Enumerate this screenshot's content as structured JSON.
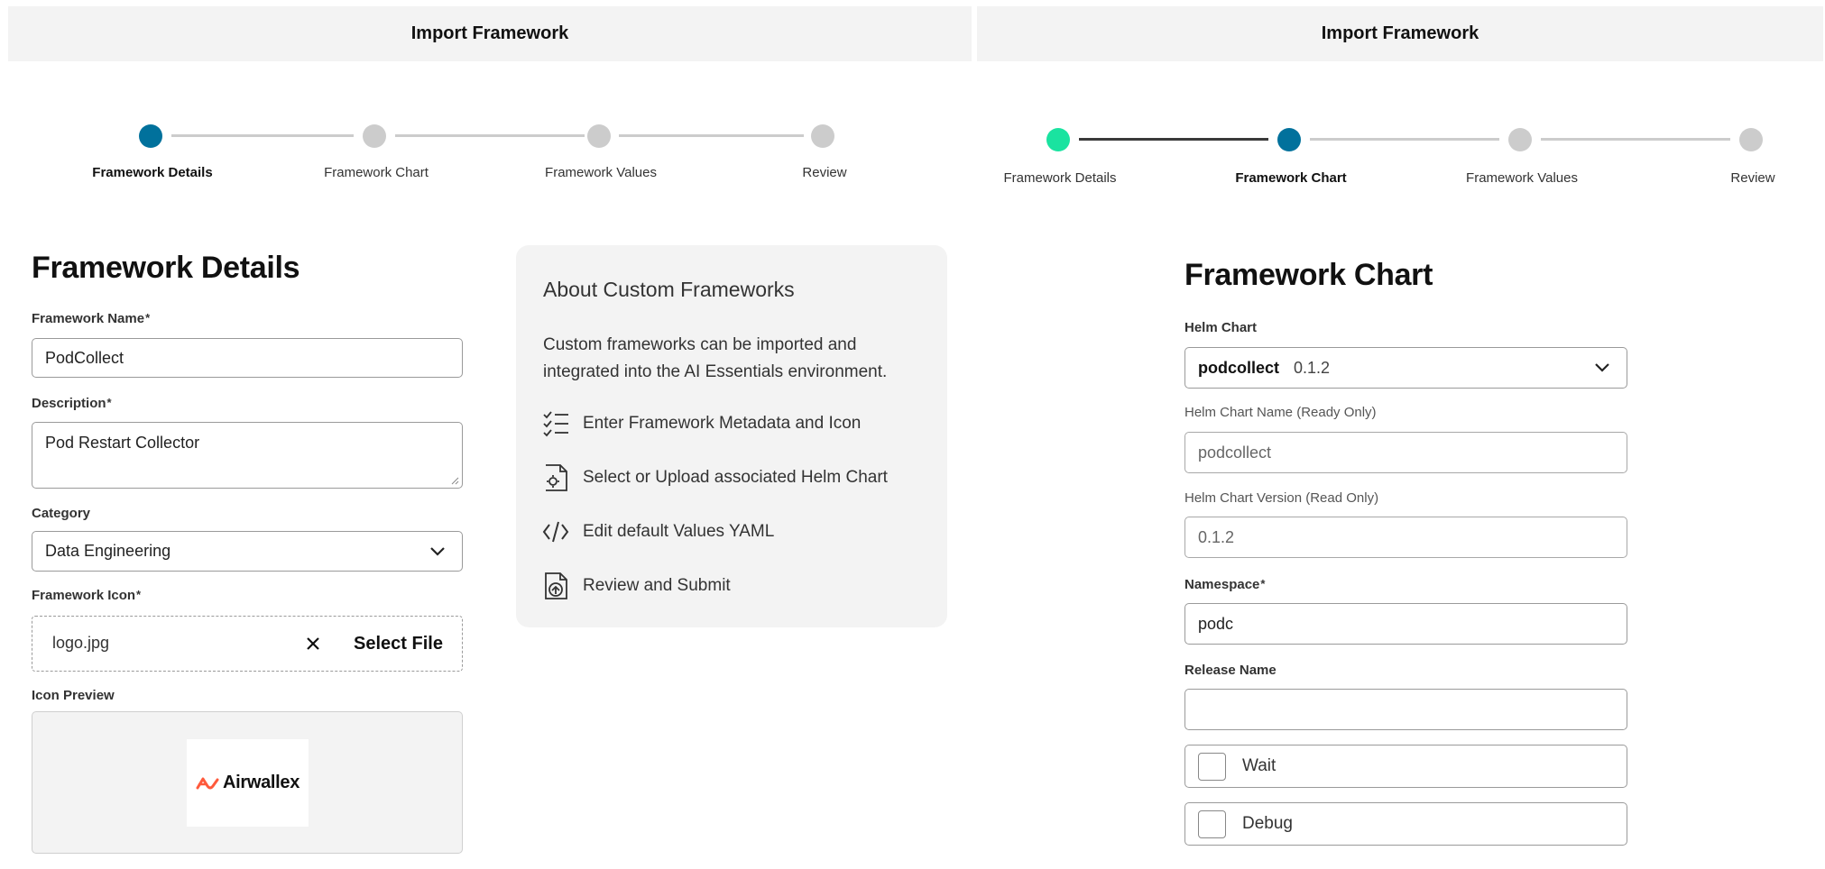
{
  "left": {
    "header_title": "Import Framework",
    "steps": [
      {
        "label": "Framework Details",
        "state": "active"
      },
      {
        "label": "Framework Chart",
        "state": "pending"
      },
      {
        "label": "Framework Values",
        "state": "pending"
      },
      {
        "label": "Review",
        "state": "pending"
      }
    ],
    "section_title": "Framework Details",
    "framework_name": {
      "label": "Framework Name",
      "required": "*",
      "value": "PodCollect"
    },
    "description": {
      "label": "Description",
      "required": "*",
      "value": "Pod Restart Collector"
    },
    "category": {
      "label": "Category",
      "value": "Data Engineering"
    },
    "framework_icon": {
      "label": "Framework Icon",
      "required": "*",
      "file_name": "logo.jpg",
      "select_label": "Select File"
    },
    "icon_preview": {
      "label": "Icon Preview",
      "logo_text": "Airwallex"
    },
    "about": {
      "title": "About Custom Frameworks",
      "text": "Custom frameworks can be imported and integrated into the AI Essentials environment.",
      "items": [
        {
          "icon": "checklist-icon",
          "label": "Enter Framework Metadata and Icon"
        },
        {
          "icon": "chart-file-icon",
          "label": "Select or Upload associated Helm Chart"
        },
        {
          "icon": "code-icon",
          "label": "Edit default Values YAML"
        },
        {
          "icon": "upload-file-icon",
          "label": "Review and Submit"
        }
      ]
    }
  },
  "right": {
    "header_title": "Import Framework",
    "steps": [
      {
        "label": "Framework Details",
        "state": "done"
      },
      {
        "label": "Framework Chart",
        "state": "active"
      },
      {
        "label": "Framework Values",
        "state": "pending"
      },
      {
        "label": "Review",
        "state": "pending"
      }
    ],
    "section_title": "Framework Chart",
    "helm_chart": {
      "label": "Helm Chart",
      "name": "podcollect",
      "version": "0.1.2"
    },
    "helm_chart_name": {
      "label": "Helm Chart Name (Ready Only)",
      "value": "podcollect"
    },
    "helm_chart_version": {
      "label": "Helm Chart Version (Read Only)",
      "value": "0.1.2"
    },
    "namespace": {
      "label": "Namespace",
      "required": "*",
      "value": "podc"
    },
    "release_name": {
      "label": "Release Name",
      "value": ""
    },
    "wait": {
      "label": "Wait"
    },
    "debug": {
      "label": "Debug"
    }
  },
  "colors": {
    "active_step": "#01719c",
    "done_step": "#1ae3a0",
    "pending_step": "#cccccc",
    "header_bg": "#f3f3f3",
    "logo_orange": "#ff5a3c"
  }
}
